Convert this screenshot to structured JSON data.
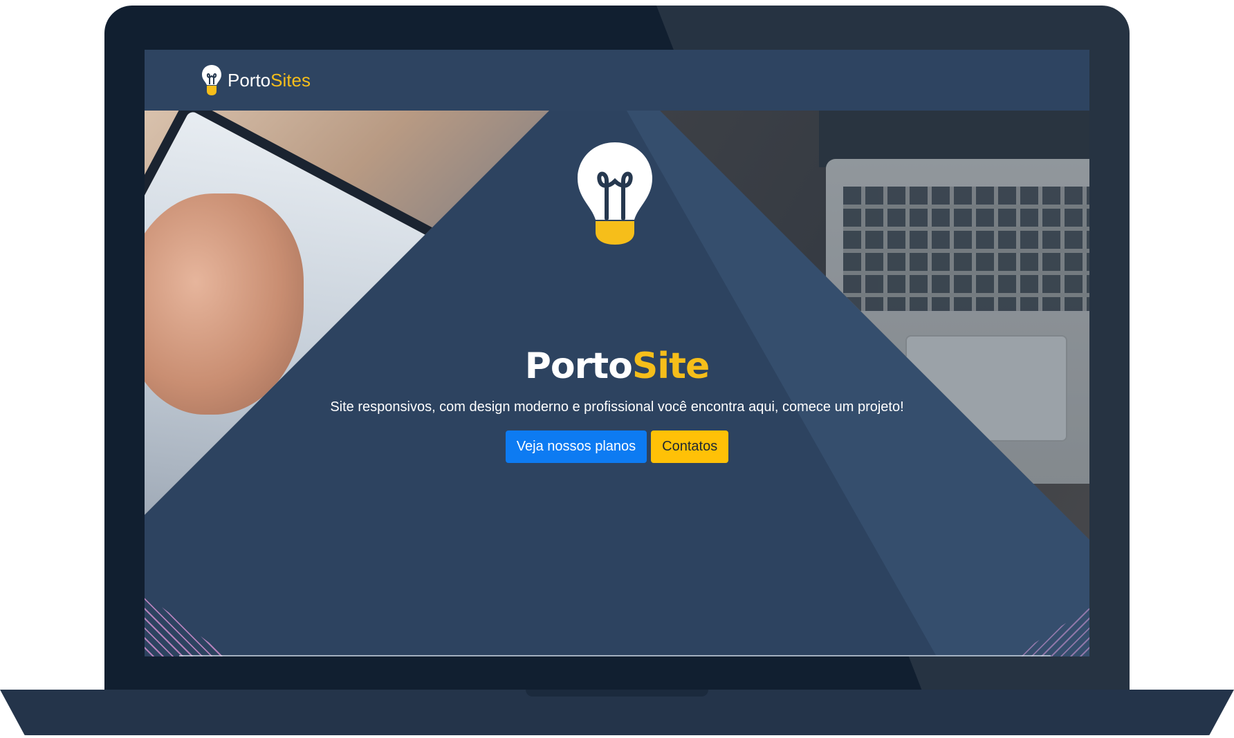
{
  "navbar": {
    "brand_main": "Porto",
    "brand_accent": "Sites",
    "logo_icon": "lightbulb-icon"
  },
  "hero": {
    "title_main": "Porto",
    "title_accent": "Site",
    "subtitle": "Site responsivos, com design moderno e profissional você encontra aqui, comece um projeto!",
    "hero_icon": "lightbulb-icon",
    "buttons": {
      "plans_label": "Veja nossos planos",
      "contact_label": "Contatos"
    }
  },
  "colors": {
    "accent": "#f6be1a",
    "primary_button": "#0d7bf2",
    "warning_button": "#ffc107",
    "hero_background": "#2d4360",
    "navbar_background": "#2e4461",
    "laptop_frame": "#111f30"
  }
}
